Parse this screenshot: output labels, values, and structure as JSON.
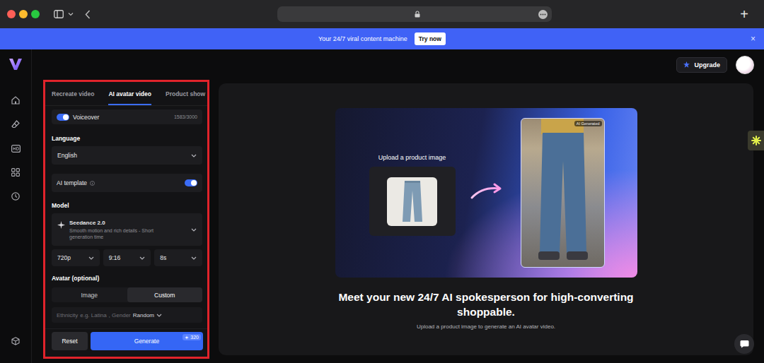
{
  "browser": {
    "new_tab": "+"
  },
  "banner": {
    "text": "Your 24/7 viral content machine",
    "button": "Try now",
    "close": "×"
  },
  "header": {
    "upgrade": "Upgrade"
  },
  "panel": {
    "tabs": [
      {
        "label": "Recreate video",
        "selected": false
      },
      {
        "label": "AI avatar video",
        "selected": true
      },
      {
        "label": "Product show",
        "selected": false
      }
    ],
    "voiceover": {
      "label": "Voiceover",
      "on": true,
      "count": "1583/3000"
    },
    "language": {
      "label": "Language",
      "value": "English"
    },
    "ai_template": {
      "label": "AI template",
      "on": true
    },
    "model": {
      "label": "Model",
      "name": "Seedance 2.0",
      "description": "Smooth motion and rich details - Short generation time"
    },
    "options": [
      {
        "value": "720p"
      },
      {
        "value": "9:16"
      },
      {
        "value": "8s"
      }
    ],
    "avatar": {
      "label": "Avatar (optional)",
      "modes": [
        {
          "label": "Image",
          "selected": false
        },
        {
          "label": "Custom",
          "selected": true
        }
      ],
      "ethnicity_label": "Ethnicity",
      "ethnicity_placeholder": "e.g. Latina",
      "gender_label": ", Gender",
      "gender_value": "Random"
    },
    "reset": "Reset",
    "generate": "Generate",
    "cost": "320"
  },
  "hero": {
    "upload_label": "Upload a product image",
    "badge": "AI Generated",
    "title": "Meet your new 24/7 AI spokesperson for high-converting shoppable.",
    "subtitle": "Upload a product image to generate an AI avatar video."
  }
}
